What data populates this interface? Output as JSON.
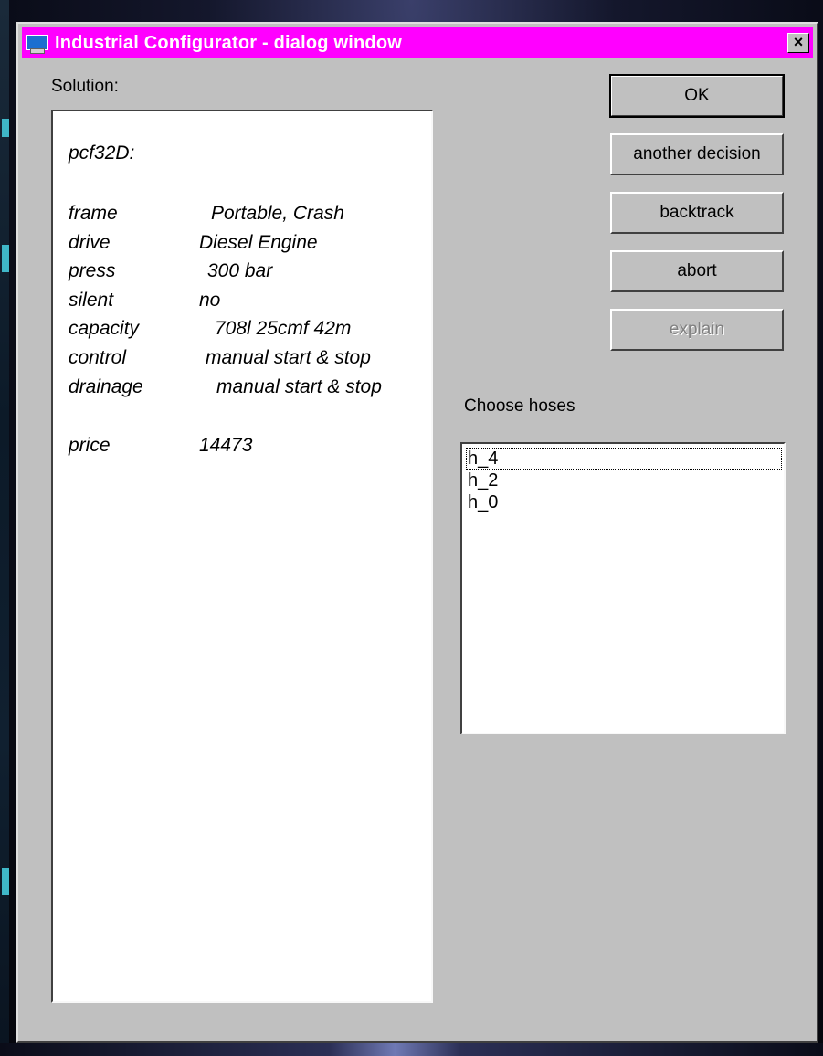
{
  "window": {
    "title": "Industrial Configurator - dialog window",
    "close_glyph": "×"
  },
  "solution": {
    "label": "Solution:",
    "header": "pcf32D:",
    "rows": [
      {
        "key": "frame",
        "value": "Portable, Crash"
      },
      {
        "key": "drive",
        "value": "Diesel Engine"
      },
      {
        "key": "press",
        "value": "300 bar"
      },
      {
        "key": "silent",
        "value": "no"
      },
      {
        "key": "capacity",
        "value": "708l 25cmf 42m"
      },
      {
        "key": "control",
        "value": "manual start & stop"
      },
      {
        "key": "drainage",
        "value": "manual start & stop"
      },
      {
        "key": "price",
        "value": "14473"
      }
    ]
  },
  "buttons": {
    "ok": "OK",
    "another_decision": "another decision",
    "backtrack": "backtrack",
    "abort": "abort",
    "explain": "explain"
  },
  "hoses": {
    "label": "Choose hoses",
    "items": [
      "h_4",
      "h_2",
      "h_0"
    ],
    "focused_index": 0
  },
  "colors": {
    "titlebar": "#ff00ff",
    "dialog_face": "#c0c0c0"
  }
}
